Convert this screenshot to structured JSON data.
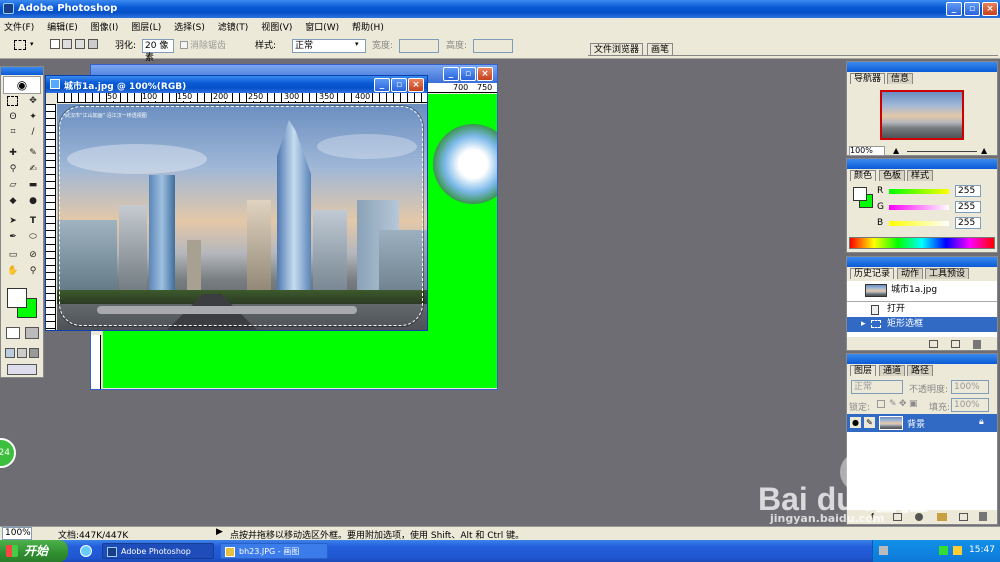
{
  "app": {
    "title": "Adobe Photoshop"
  },
  "menubar": [
    "文件(F)",
    "编辑(E)",
    "图像(I)",
    "图层(L)",
    "选择(S)",
    "滤镜(T)",
    "视图(V)",
    "窗口(W)",
    "帮助(H)"
  ],
  "options": {
    "feather_label": "羽化:",
    "feather_value": "20 像素",
    "antialias_label": "消除锯齿",
    "style_label": "样式:",
    "style_value": "正常",
    "width_label": "宽度:",
    "height_label": "高度:",
    "tab_file_browser": "文件浏览器",
    "tab_brushes": "画笔"
  },
  "document": {
    "title": "城市1a.jpg @ 100%(RGB)",
    "caption": "武汉市“江山如画”·沿江汉一桥透视图",
    "ruler_h": [
      "50",
      "100",
      "150",
      "200",
      "250",
      "300",
      "350",
      "400"
    ],
    "ruler_v": [
      "50",
      "100",
      "150",
      "200",
      "250",
      "300",
      "350"
    ],
    "back_ruler_h": [
      "700",
      "750"
    ]
  },
  "navigator": {
    "tab_nav": "导航器",
    "tab_info": "信息",
    "zoom": "100%"
  },
  "color": {
    "tab_color": "色板",
    "tab_color_main": "颜色",
    "tab_styles": "样式",
    "r_label": "R",
    "g_label": "G",
    "b_label": "B",
    "r": "255",
    "g": "255",
    "b": "255"
  },
  "history": {
    "tab_history": "历史记录",
    "tab_actions": "动作",
    "tab_presets": "工具预设",
    "snapshot": "城市1a.jpg",
    "items": [
      "打开",
      "矩形选框"
    ]
  },
  "layers": {
    "tab_layers": "图层",
    "tab_channels": "通道",
    "tab_paths": "路径",
    "blend": "正常",
    "opacity_label": "不透明度:",
    "opacity": "100%",
    "lock_label": "锁定:",
    "fill_label": "填充:",
    "fill": "100%",
    "layer_name": "背景"
  },
  "status": {
    "zoom": "100%",
    "doc": "文档:447K/447K",
    "hint": "点按并拖移以移动选区外框。要用附加选项，使用 Shift、Alt 和 Ctrl 键。"
  },
  "taskbar": {
    "start": "开始",
    "task1": "Adobe Photoshop",
    "task2": "bh23.JPG - 画图",
    "clock": "15:47",
    "badge": "24"
  },
  "watermark": {
    "site": "jingyan.baidu.com"
  },
  "colors": {
    "title_blue": "#0a5bd6",
    "canvas_green": "#00ff00",
    "workspace": "#6e6d74",
    "palette_bg": "#ece9d8",
    "selection": "#316ac5"
  }
}
